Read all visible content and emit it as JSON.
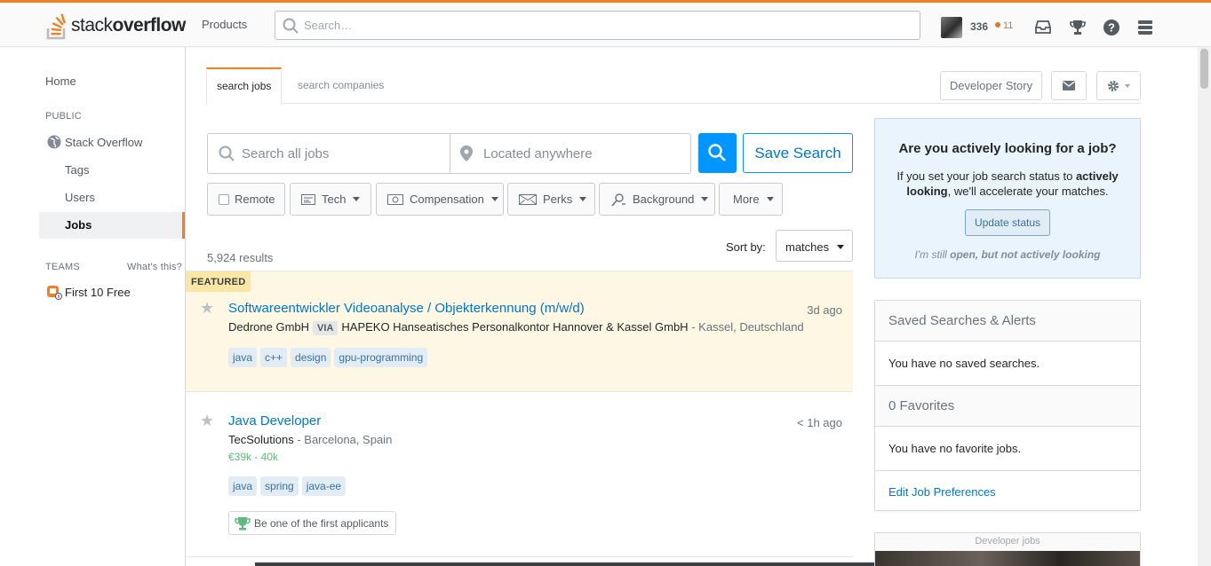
{
  "topbar": {
    "logo_light": "stack",
    "logo_bold": "overflow",
    "products": "Products",
    "search_placeholder": "Search…",
    "reputation": "336",
    "bronze_badges": "11"
  },
  "sidebar": {
    "home": "Home",
    "public": "PUBLIC",
    "stack_overflow": "Stack Overflow",
    "tags": "Tags",
    "users": "Users",
    "jobs": "Jobs",
    "teams": "TEAMS",
    "whats_this": "What's this?",
    "first_free": "First 10 Free"
  },
  "tabs": {
    "search_jobs": "search jobs",
    "search_companies": "search companies",
    "developer_story": "Developer Story"
  },
  "search": {
    "jobs_placeholder": "Search all jobs",
    "location_placeholder": "Located anywhere",
    "save_search": "Save Search"
  },
  "filters": {
    "remote": "Remote",
    "tech": "Tech",
    "compensation": "Compensation",
    "perks": "Perks",
    "background": "Background",
    "more": "More"
  },
  "results": {
    "count": "5,924 results",
    "sort_label": "Sort by:",
    "sort_value": "matches"
  },
  "jobs": [
    {
      "badge": "FEATURED",
      "title": "Softwareentwickler Videoanalyse / Objekterkennung (m/w/d)",
      "age": "3d ago",
      "company": "Dedrone GmbH",
      "via": "VIA",
      "agency": "HAPEKO Hanseatisches Personalkontor Hannover & Kassel GmbH",
      "location": "- Kassel, Deutschland",
      "tags": [
        "java",
        "c++",
        "design",
        "gpu-programming"
      ]
    },
    {
      "title": "Java Developer",
      "age": "< 1h ago",
      "company": "TecSolutions",
      "location": "- Barcelona, Spain",
      "salary": "€39k - 40k",
      "tags": [
        "java",
        "spring",
        "java-ee"
      ],
      "first_applicants": "Be one of the first applicants"
    }
  ],
  "right": {
    "active_title": "Are you actively looking for a job?",
    "active_text_1": "If you set your job search status to ",
    "active_text_bold1": "actively looking",
    "active_text_2": ", we'll accelerate your matches.",
    "update_status": "Update status",
    "still_open_1": "I'm still ",
    "still_open_bold": "open, but not actively looking",
    "saved_header": "Saved Searches & Alerts",
    "no_saved": "You have no saved searches.",
    "favorites_header": "0 Favorites",
    "no_favorites": "You have no favorite jobs.",
    "edit_prefs": "Edit Job Preferences",
    "developer_jobs": "Developer jobs"
  },
  "colors": {
    "accent": "#f48024",
    "link": "#0077cc",
    "button_blue": "#0095ff",
    "featured_bg": "#fdf7e3",
    "salary_green": "#5eba7d"
  }
}
